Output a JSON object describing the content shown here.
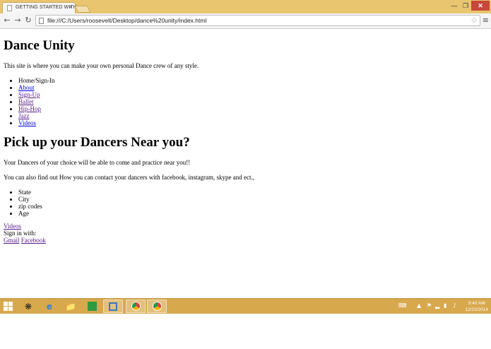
{
  "browser": {
    "tab_title": "GETTING STARTED WITH",
    "tab_close": "×",
    "url": "file:///C:/Users/roosevelt/Desktop/dance%20unity/index.html",
    "back_icon": "back-arrow-icon",
    "forward_icon": "forward-arrow-icon",
    "reload_icon": "reload-icon"
  },
  "page": {
    "heading1": "Dance Unity",
    "intro": "This site is where you can make your own personal Dance crew of any style.",
    "nav_items": [
      {
        "label": "Home/Sign-In",
        "link": false
      },
      {
        "label": "About",
        "link": true
      },
      {
        "label": "Sign-Up",
        "link": true
      },
      {
        "label": "Ballet",
        "link": true
      },
      {
        "label": "Hip-Hop",
        "link": true
      },
      {
        "label": "Jazz",
        "link": true
      },
      {
        "label": "Videos",
        "link": true
      }
    ],
    "heading2": "Pick up your Dancers Near you?",
    "para1": "Your Dancers of your choice will be able to come and practice near you!!",
    "para2": "You can also find out How you can contact your dancers with facebook, instagram, skype and ect.,",
    "filters": [
      "State",
      "City",
      "zip codes",
      "Age"
    ],
    "videos_link": "Videos",
    "sign_in_label": "Sign in with:",
    "gmail_link": "Gmail",
    "facebook_link": "Facebook"
  },
  "taskbar": {
    "time": "9:40 AM",
    "date": "12/22/2014"
  }
}
